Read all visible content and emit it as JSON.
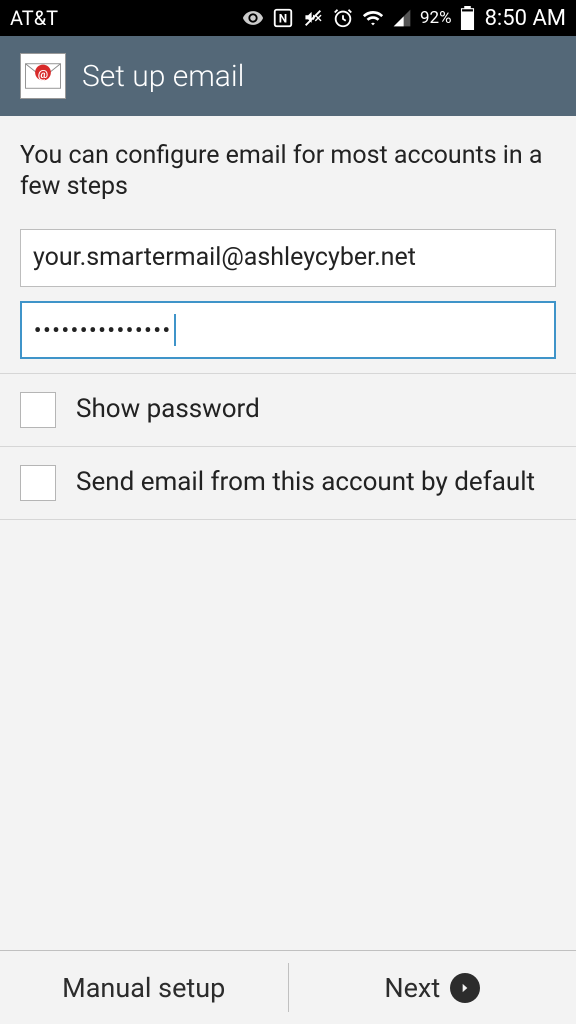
{
  "statusBar": {
    "carrier": "AT&T",
    "battery": "92%",
    "time": "8:50 AM"
  },
  "appBar": {
    "title": "Set up email"
  },
  "content": {
    "instructions": "You can configure email for most accounts in a few steps",
    "emailValue": "your.smartermail@ashleycyber.net",
    "passwordValue": "•••••••••••••••",
    "showPasswordLabel": "Show password",
    "defaultAccountLabel": "Send email from this account by default"
  },
  "bottomBar": {
    "manualSetup": "Manual setup",
    "next": "Next"
  }
}
